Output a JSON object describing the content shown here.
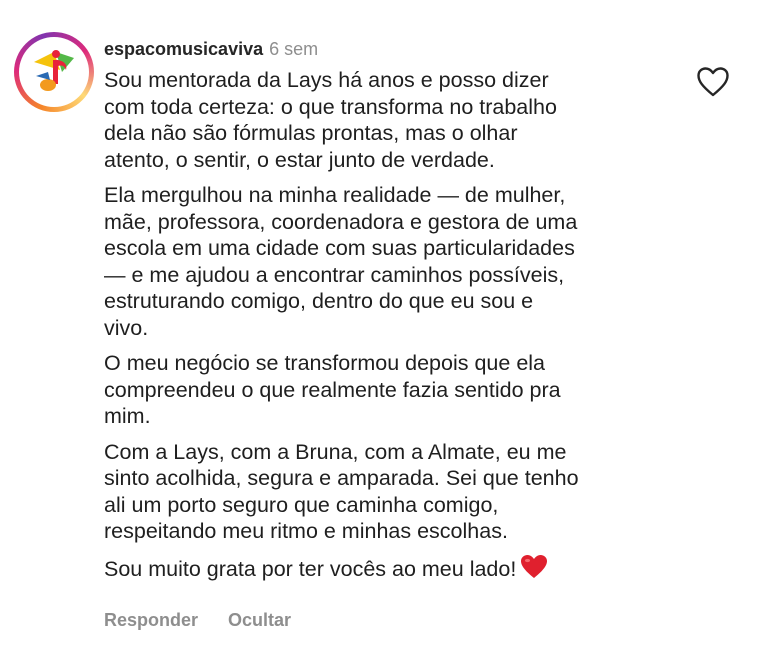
{
  "comment": {
    "username": "espacomusicaviva",
    "time": "6 sem",
    "paragraphs": [
      "Sou mentorada da Lays há anos e posso dizer\ncom toda certeza: o que transforma no trabalho\ndela não são fórmulas prontas, mas o olhar\natento, o sentir, o estar junto de verdade.",
      "Ela mergulhou na minha realidade — de mulher,\nmãe, professora, coordenadora e gestora de uma\nescola em uma cidade com suas particularidades\n— e me ajudou a encontrar caminhos possíveis,\nestruturando comigo, dentro do que eu sou e\nvivo.",
      "O meu negócio se transformou depois que ela\ncompreendeu o que realmente fazia sentido pra\nmim.",
      "Com a Lays, com a Bruna, com a Almate, eu me\nsinto acolhida, segura e amparada. Sei que tenho\nali um porto seguro que caminha comigo,\nrespeitando meu ritmo e minhas escolhas."
    ],
    "last_paragraph": "Sou muito grata por ter vocês ao meu lado!",
    "emoji": "red-heart-emoji"
  },
  "actions": {
    "reply_label": "Responder",
    "hide_label": "Ocultar"
  },
  "icons": {
    "like": "heart-outline-icon",
    "avatar": "music-logo-avatar"
  },
  "colors": {
    "text": "#1f1f1f",
    "muted": "#8e8e8e",
    "heart": "#e0202e"
  }
}
